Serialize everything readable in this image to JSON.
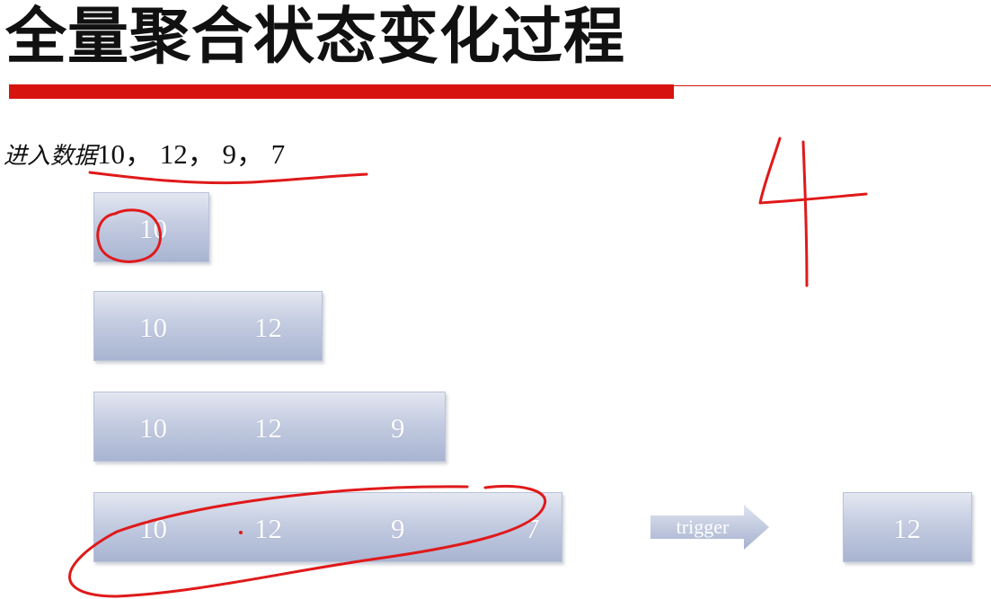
{
  "slide": {
    "title": "全量聚合状态变化过程",
    "input_label": "进入数据",
    "input_values": "10， 12， 9， 7"
  },
  "rows": [
    {
      "values": [
        "10"
      ]
    },
    {
      "values": [
        "10",
        "12"
      ]
    },
    {
      "values": [
        "10",
        "12",
        "9"
      ]
    },
    {
      "values": [
        "10",
        "12",
        "9",
        "7"
      ]
    }
  ],
  "trigger": {
    "label": "trigger",
    "result": "12"
  },
  "annotation": {
    "handwritten_number": "4"
  },
  "colors": {
    "accent_bar": "#d7130f",
    "ink": "#e0191a",
    "box_top": "#e3e7f1",
    "box_bottom": "#a8b4d1"
  }
}
